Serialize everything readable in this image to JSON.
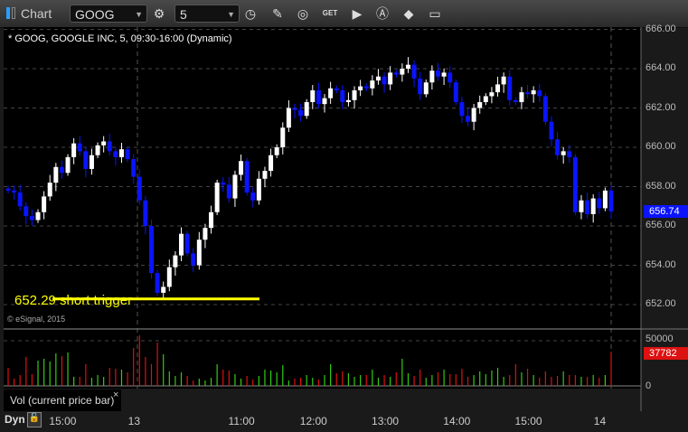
{
  "toolbar": {
    "title": "Chart",
    "symbol": "GOOG",
    "interval": "5"
  },
  "chart_header": "* GOOG, GOOGLE INC, 5, 09:30-16:00 (Dynamic)",
  "copyright": "© eSignal, 2015",
  "annotation": {
    "label": "652.29 short trigger",
    "price": 652.29,
    "color": "#ffff00"
  },
  "volume_label": "Vol (current price bar)",
  "bottom": {
    "mode": "Dyn"
  },
  "colors": {
    "up": "#ffffff",
    "down": "#0a14ff",
    "vol_up": "#33cc11",
    "vol_down": "#dd1111"
  },
  "chart_data": {
    "type": "candlestick",
    "ylim": [
      651.3,
      666
    ],
    "y_ticks": [
      "652.00",
      "654.00",
      "656.00",
      "658.00",
      "660.00",
      "662.00",
      "664.00",
      "666.00"
    ],
    "y_tick_values": [
      652,
      654,
      656,
      658,
      660,
      662,
      664,
      666
    ],
    "last_price": "656.74",
    "x_labels": [
      "15:00",
      "13",
      "11:00",
      "12:00",
      "13:00",
      "14:00",
      "15:00",
      "14"
    ],
    "x_label_bars": [
      9,
      21,
      39,
      51,
      63,
      75,
      87,
      99
    ],
    "closes": [
      657.8,
      657.7,
      657.0,
      656.5,
      656.3,
      656.7,
      657.5,
      658.2,
      659.0,
      658.7,
      659.5,
      660.2,
      659.8,
      658.9,
      659.6,
      660.1,
      660.3,
      659.8,
      659.5,
      659.9,
      659.4,
      658.5,
      657.3,
      656.0,
      653.6,
      652.6,
      652.9,
      653.9,
      654.5,
      655.6,
      654.6,
      654.0,
      655.3,
      655.9,
      656.7,
      658.2,
      658.1,
      657.4,
      658.6,
      659.3,
      657.7,
      657.3,
      658.4,
      658.8,
      659.6,
      660.0,
      661.0,
      662.0,
      661.9,
      661.6,
      662.3,
      662.9,
      662.2,
      662.5,
      663.0,
      662.9,
      662.3,
      662.4,
      662.9,
      663.1,
      663.0,
      663.4,
      663.6,
      663.2,
      663.8,
      663.7,
      664.0,
      664.2,
      663.5,
      662.7,
      663.3,
      663.9,
      663.6,
      663.8,
      663.3,
      662.3,
      661.6,
      661.3,
      662.0,
      662.3,
      662.6,
      662.8,
      663.2,
      663.6,
      662.4,
      662.3,
      662.8,
      662.7,
      662.9,
      662.6,
      661.3,
      660.4,
      659.6,
      659.8,
      659.5,
      656.7,
      657.3,
      656.6,
      657.4,
      656.9,
      657.8,
      656.74
    ],
    "volume": {
      "ylim": [
        0,
        60000
      ],
      "ticks": [
        "0",
        "50000"
      ],
      "last": "37782",
      "values": [
        20000,
        8000,
        12000,
        32000,
        13000,
        28000,
        30000,
        27000,
        36000,
        33000,
        37000,
        10000,
        10000,
        24000,
        9000,
        12000,
        10000,
        20000,
        19000,
        18000,
        15000,
        42000,
        56000,
        32000,
        24000,
        48000,
        35000,
        16000,
        11000,
        15000,
        11000,
        6000,
        8000,
        6000,
        9000,
        24000,
        18000,
        17000,
        13000,
        8000,
        11000,
        7000,
        11000,
        18000,
        17000,
        15000,
        23000,
        6000,
        8000,
        9000,
        12000,
        9000,
        7000,
        12000,
        24000,
        14000,
        16000,
        14000,
        10000,
        12000,
        12000,
        18000,
        9000,
        12000,
        10000,
        15000,
        30000,
        14000,
        11000,
        18000,
        9000,
        12000,
        15000,
        18000,
        13000,
        13000,
        19000,
        10000,
        12000,
        16000,
        13000,
        17000,
        20000,
        10000,
        12000,
        24000,
        15000,
        19000,
        12000,
        9000,
        16000,
        10000,
        11000,
        16000,
        12000,
        12000,
        10000,
        10000,
        12000,
        9000,
        12000,
        37782
      ]
    }
  }
}
